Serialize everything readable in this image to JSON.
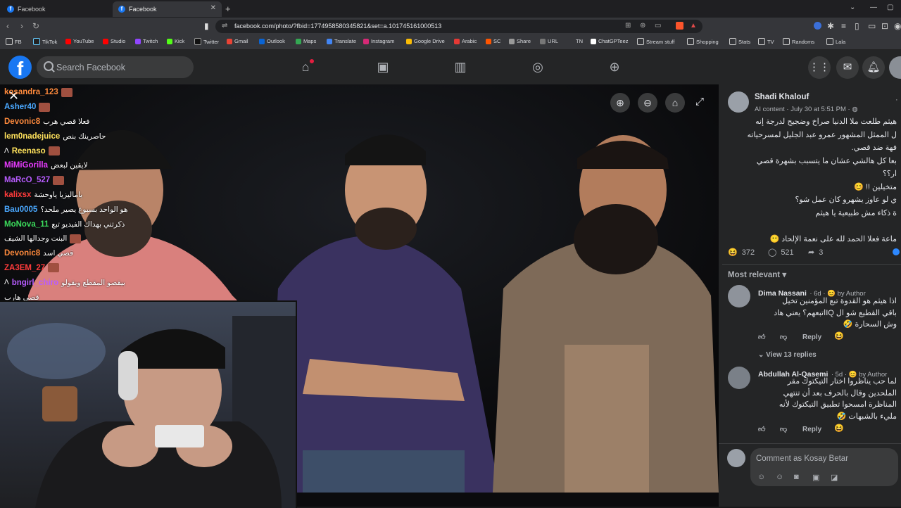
{
  "browser": {
    "tabs": [
      {
        "title": "Facebook"
      },
      {
        "title": "Facebook"
      }
    ],
    "url": "facebook.com/photo/?fbid=1774958580345821&set=a.101745161000513",
    "bookmarks": [
      "FB",
      "TikTok",
      "YouTube",
      "Studio",
      "Twitch",
      "Kick",
      "Twitter",
      "Gmail",
      "Outlook",
      "Maps",
      "Translate",
      "Instagram",
      "Google Drive",
      "Arabic",
      "SC",
      "Share",
      "URL",
      "TN",
      "ChatGPTeez",
      "Stream stuff",
      "Shopping",
      "Stats",
      "TV",
      "Randoms",
      "Lala"
    ]
  },
  "facebook": {
    "logo": "f",
    "search_placeholder": "Search Facebook",
    "icons": [
      "home-icon",
      "video-icon",
      "marketplace-icon",
      "groups-icon",
      "gaming-icon"
    ]
  },
  "chat": [
    {
      "user": "kosandra_123",
      "color": "#ff8a3c",
      "text": ""
    },
    {
      "user": "Asher40",
      "color": "#4aa8ff",
      "text": ""
    },
    {
      "user": "Devonic8",
      "color": "#ff8a3c",
      "text": "فعلا قصي هرب"
    },
    {
      "user": "lem0nadejuice",
      "color": "#ffe25c",
      "text": "حاصرينك بنص"
    },
    {
      "user": "Reenaso",
      "color": "#ffe25c",
      "text": ""
    },
    {
      "user": "MiMiGorilla",
      "color": "#e83bff",
      "text": "لايقين لبعض"
    },
    {
      "user": "MaRcO_527",
      "color": "#b85cff",
      "text": ""
    },
    {
      "user": "kalixsx",
      "color": "#ff3b3b",
      "text": "ياماليزيا ياوحشة"
    },
    {
      "user": "Bau0005",
      "color": "#4aa8ff",
      "text": "هو الواحد بسبوع يصير ملحد؟"
    },
    {
      "user": "MoNova_11",
      "color": "#3cdc5c",
      "text": "ذكرتني بهداك الفيديو تبع"
    },
    {
      "user": "",
      "color": "#ffffff",
      "text": "البنت وجدالها الشيف"
    },
    {
      "user": "Devonic8",
      "color": "#ff8a3c",
      "text": "قصي اسد"
    },
    {
      "user": "ZA3EM_27",
      "color": "#ff3b3b",
      "text": ""
    },
    {
      "user": "bngirl_chiro",
      "color": "#b85cff",
      "text": "بيقصو المقطع وبقولو"
    },
    {
      "user": "",
      "color": "#ffffff",
      "text": "قصي هارب"
    }
  ],
  "post": {
    "author": "Shadi Khalouf",
    "meta": "AI content · July 30 at 5:51 PM · ",
    "lines": [
      "هيثم طلعت ملا الدنيا صراخ وضجيج لدرجة إنه",
      "ل الممثل المشهور عمرو عبد الجليل لمسرحياته",
      "فهة ضد قصي.",
      "بعا كل هالشي عشان ما يتسبب بشهرة قصي",
      "ار؟؟",
      "متخيلين !! 😊",
      "ي لو عاوز يشهرو كان عمل شو؟",
      "ة ذكاء مش طبيعية يا هيثم",
      "",
      "ماعة فعلا الحمد لله على نعمة الإلحاد 😶"
    ],
    "reactions": "372",
    "comments_count": "521",
    "shares": "3"
  },
  "most_relevant": "Most relevant",
  "comments": [
    {
      "name": "Dima Nassani",
      "meta": "· 6d · 😊 by Author",
      "lines": [
        "اذا هيثم هو القدوة تبع المؤمنين تخيل",
        "باقي القطيع شو ال IQاتبعهم؟ يعني هاد",
        "وش السحارة 🤣"
      ],
      "reply": "Reply",
      "replies": "View 13 replies"
    },
    {
      "name": "Abdullah Al-Qasemi",
      "meta": "· 5d · 😊 by Author",
      "lines": [
        "لما حب يناظروا اختار التيكتوك مقر",
        "الملحدين وقال بالحرف بعد أن تنتهي",
        "المناظرة امسحوا تطبيق التيكتوك لأنه",
        "مليء بالشبهات 🤣"
      ],
      "reply": "Reply"
    }
  ],
  "comment_placeholder": "Comment as Kosay Betar"
}
